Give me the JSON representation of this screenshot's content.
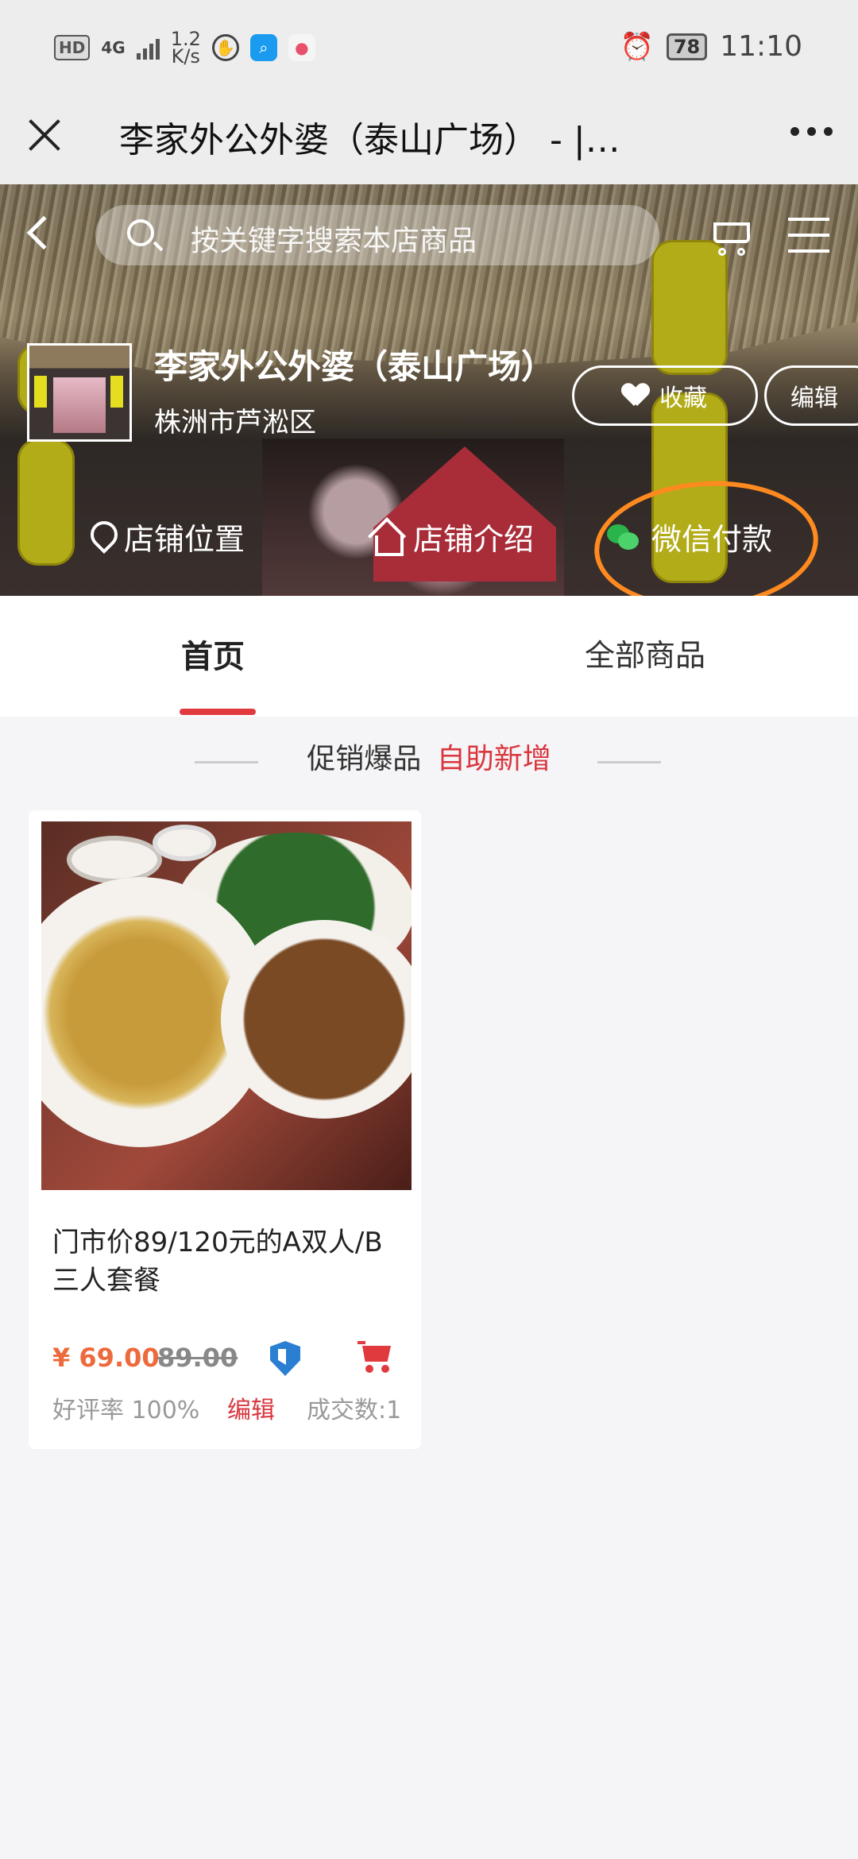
{
  "status_bar": {
    "hd": "HD",
    "network": "4G",
    "speed_value": "1.2",
    "speed_unit": "K/s",
    "battery": "78",
    "time": "11:10"
  },
  "titlebar": {
    "title": "李家外公外婆（泰山广场） - |…"
  },
  "header": {
    "search_placeholder": "按关键字搜索本店商品",
    "shop_name": "李家外公外婆（泰山广场）",
    "shop_area": "株洲市芦淞区",
    "favorite_label": "收藏",
    "edit_label": "编辑",
    "actions": [
      {
        "label": "店铺位置",
        "icon": "location-pin-icon"
      },
      {
        "label": "店铺介绍",
        "icon": "home-icon"
      },
      {
        "label": "微信付款",
        "icon": "wechat-pay-icon"
      }
    ],
    "highlight_color": "#ff8a1f"
  },
  "tabs": [
    {
      "label": "首页",
      "active": true
    },
    {
      "label": "全部商品",
      "active": false
    }
  ],
  "section": {
    "title": "促销爆品",
    "action": "自助新增"
  },
  "products": [
    {
      "name": "门市价89/120元的A双人/B三人套餐",
      "price": "¥ 69.00",
      "original_price": "89.00",
      "rating": "好评率 100%",
      "edit_label": "编辑",
      "deals": "成交数:1"
    }
  ],
  "colors": {
    "accent_red": "#e0393e",
    "price_orange": "#ec6a3c"
  }
}
